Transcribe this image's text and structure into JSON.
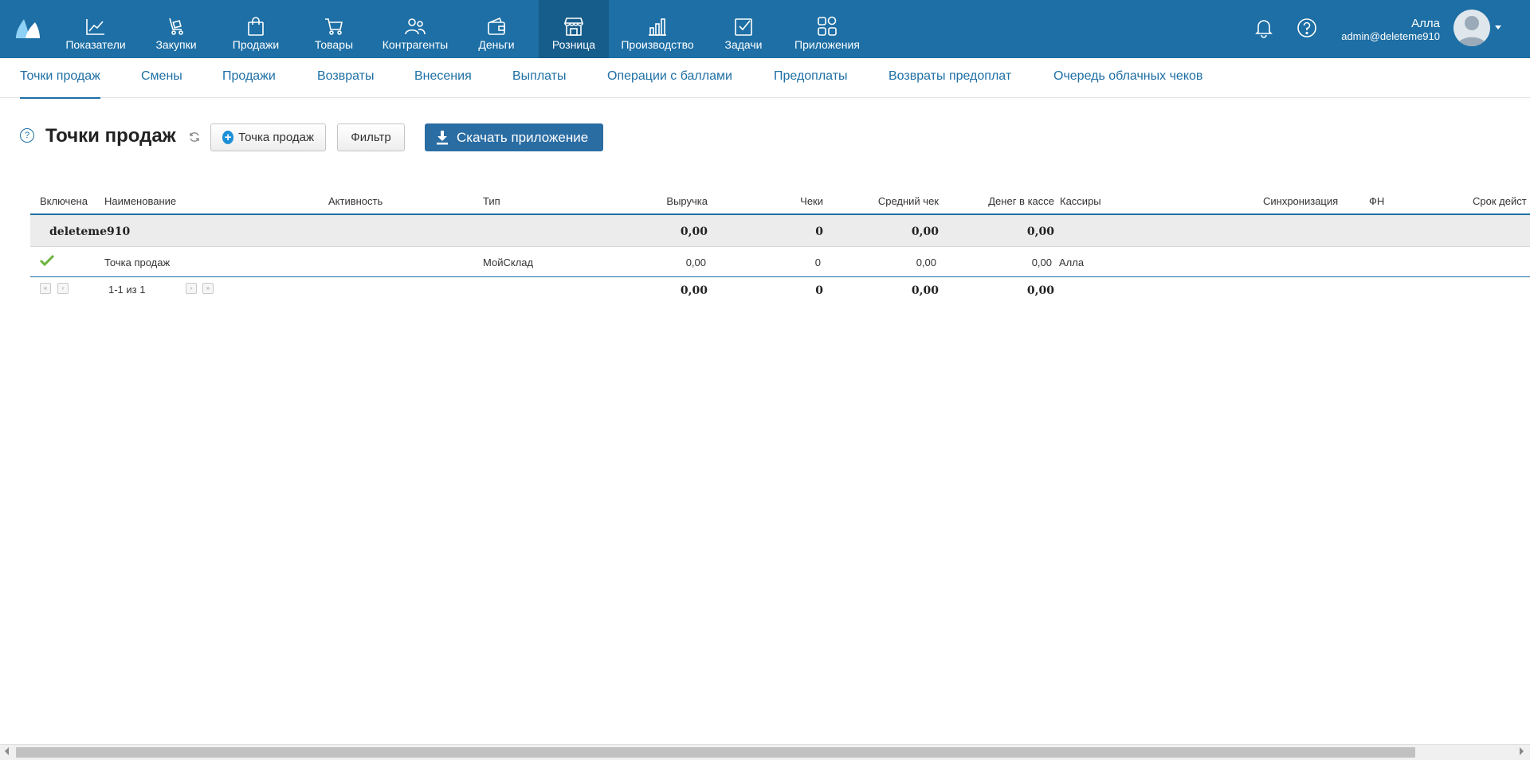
{
  "nav": {
    "items": [
      {
        "label": "Показатели",
        "icon": "chart-line-icon"
      },
      {
        "label": "Закупки",
        "icon": "cart-dolly-icon"
      },
      {
        "label": "Продажи",
        "icon": "shopping-bag-icon"
      },
      {
        "label": "Товары",
        "icon": "cart-icon"
      },
      {
        "label": "Контрагенты",
        "icon": "people-icon"
      },
      {
        "label": "Деньги",
        "icon": "wallet-icon"
      },
      {
        "label": "Розница",
        "icon": "store-icon",
        "active": true
      },
      {
        "label": "Производство",
        "icon": "factory-chart-icon"
      },
      {
        "label": "Задачи",
        "icon": "task-check-icon"
      },
      {
        "label": "Приложения",
        "icon": "apps-grid-icon"
      }
    ],
    "user_name": "Алла",
    "user_email": "admin@deleteme910"
  },
  "subnav": {
    "tabs": [
      {
        "label": "Точки продаж",
        "active": true
      },
      {
        "label": "Смены"
      },
      {
        "label": "Продажи"
      },
      {
        "label": "Возвраты"
      },
      {
        "label": "Внесения"
      },
      {
        "label": "Выплаты"
      },
      {
        "label": "Операции с баллами"
      },
      {
        "label": "Предоплаты"
      },
      {
        "label": "Возвраты предоплат"
      },
      {
        "label": "Очередь облачных чеков"
      }
    ]
  },
  "page": {
    "help": "?",
    "title": "Точки продаж",
    "add_button": "Точка продаж",
    "filter_button": "Фильтр",
    "download_button": "Скачать приложение"
  },
  "table": {
    "columns": [
      "Включена",
      "Наименование",
      "Активность",
      "Тип",
      "Выручка",
      "Чеки",
      "Средний чек",
      "Денег в кассе",
      "Кассиры",
      "Синхронизация",
      "ФН",
      "Срок дейст"
    ],
    "group": {
      "name": "deleteme910",
      "revenue": "0,00",
      "checks": "0",
      "avg_check": "0,00",
      "cash": "0,00"
    },
    "rows": [
      {
        "enabled": true,
        "name": "Точка продаж",
        "type": "МойСклад",
        "revenue": "0,00",
        "checks": "0",
        "avg_check": "0,00",
        "cash": "0,00",
        "cashiers": "Алла"
      }
    ],
    "totals": {
      "revenue": "0,00",
      "checks": "0",
      "avg_check": "0,00",
      "cash": "0,00"
    },
    "pager": {
      "range": "1-1 из 1"
    }
  },
  "colors": {
    "topbar": "#1d6fa5",
    "topbar_active": "#175d8c",
    "accent": "#1d6fa5",
    "download_button": "#2a6da3",
    "check_green": "#6db33f"
  }
}
